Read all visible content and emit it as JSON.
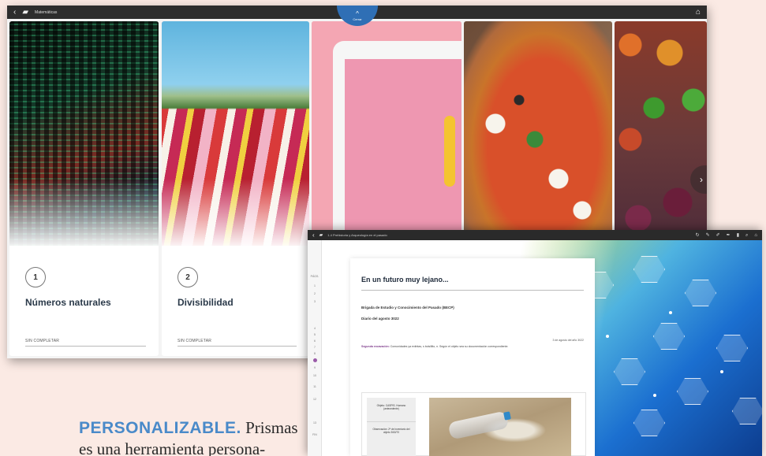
{
  "back_window": {
    "title": "Matemáticas",
    "back_icon": "chevron-left-icon",
    "book_icon": "book-icon",
    "home_icon": "home-icon",
    "top_tab_label": "Cerrar",
    "cards": [
      {
        "number": "1",
        "title": "Números naturales",
        "status": "SIN COMPLETAR"
      },
      {
        "number": "2",
        "title": "Divisibilidad",
        "status": "SIN COMPLETAR"
      }
    ],
    "next_icon": "chevron-right-icon"
  },
  "caption": {
    "keyword": "PERSONALIZABLE.",
    "text_line1": " Prismas",
    "text_line2": "es una herramienta persona-"
  },
  "front_window": {
    "title": "1.4 Prehistoria y Arqueología en el pasado",
    "tools": [
      "refresh-icon",
      "pencil-icon",
      "marker-icon",
      "highlighter-icon",
      "bookmark-icon",
      "search-icon",
      "home-icon"
    ],
    "page_labels": [
      "PÁGS.",
      "1",
      "2",
      "3",
      "4",
      "5",
      "6",
      "7",
      "8",
      "9",
      "10",
      "11",
      "12",
      "13",
      "FIN"
    ],
    "doc": {
      "title": "En un futuro muy lejano...",
      "subtitle": "Brigada de Estudio y Conocimiento del Pasado (BECP)",
      "date_line": "Diario del agosto 3022",
      "date_right": "3 de agosto del año 3022",
      "body_label": "Segunda excavación:",
      "body_text": " Comunidades ya extintas, s bolsillito, n. Según el objeto sea su documentación correspondiente.",
      "side_item1": "Objeto: CASPIS. Humano (antecedente)",
      "side_item2": "Observación: 2ª de Inventario del objeto 3/60/70"
    }
  }
}
